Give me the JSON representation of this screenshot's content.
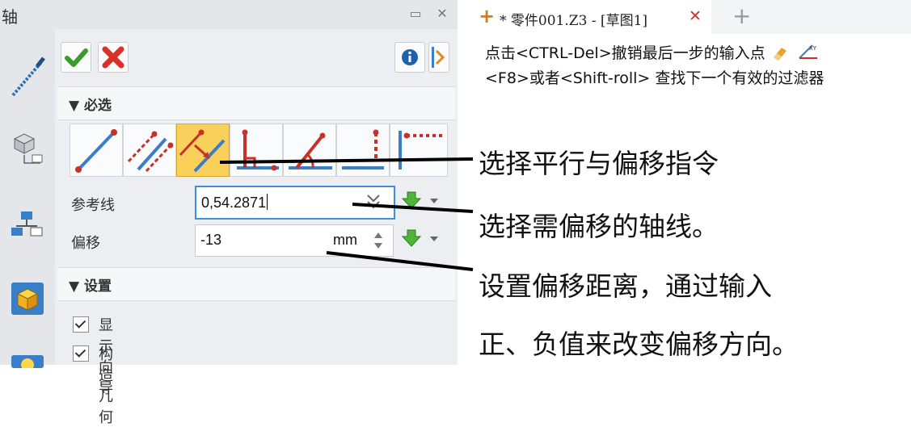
{
  "panel": {
    "title": "轴",
    "required_section": "▼ 必选",
    "settings_section": "▼ 设置",
    "fields": {
      "reference_line_label": "参考线",
      "reference_line_value": "0,54.2871",
      "offset_label": "偏移",
      "offset_value": "-13",
      "offset_unit": "mm"
    },
    "checkboxes": [
      {
        "label": "显示向导",
        "checked": true
      },
      {
        "label": "构造几何",
        "checked": true
      }
    ],
    "tools": [
      "two-point-axis-icon",
      "two-line-axis-icon",
      "parallel-offset-axis-icon",
      "perpendicular-axis-icon",
      "angle-axis-icon",
      "point-axis-icon",
      "point-direction-axis-icon"
    ]
  },
  "tab": {
    "label": "* 零件001.Z3 - [草图1]",
    "close_glyph": "✕",
    "add_glyph": "+"
  },
  "info": {
    "line1": "点击<CTRL-Del>撤销最后一步的输入点",
    "line2": "<F8>或者<Shift-roll> 查找下一个有效的过滤器"
  },
  "annotations": {
    "a1": "选择平行与偏移指令",
    "a2": "选择需偏移的轴线。",
    "a3": "设置偏移距离，通过输入",
    "a4": "正、负值来改变偏移方向。"
  },
  "colors": {
    "accent": "#f8d05a",
    "ok_green": "#3a9d2a",
    "cancel_red": "#d9302a",
    "line_blue": "#3a7dc9",
    "point_red": "#c8302a"
  }
}
